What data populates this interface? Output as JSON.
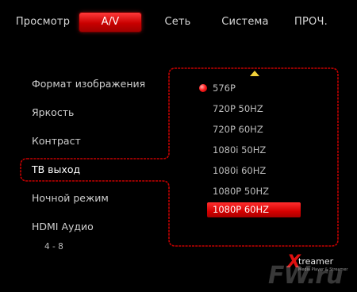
{
  "tabs": [
    {
      "label": "Просмотр"
    },
    {
      "label": "A/V"
    },
    {
      "label": "Сеть"
    },
    {
      "label": "Система"
    },
    {
      "label": "ПРОЧ."
    }
  ],
  "active_tab": "A/V",
  "menu": {
    "items": [
      {
        "label": "Формат изображения"
      },
      {
        "label": "Яркость"
      },
      {
        "label": "Контраст"
      },
      {
        "label": "ТВ выход"
      },
      {
        "label": "Ночной режим"
      },
      {
        "label": "HDMI Аудио"
      }
    ],
    "selected": "ТВ выход",
    "page_indicator": "4 - 8"
  },
  "options": {
    "items": [
      {
        "label": "576P"
      },
      {
        "label": "720P 50HZ"
      },
      {
        "label": "720P 60HZ"
      },
      {
        "label": "1080i 50HZ"
      },
      {
        "label": "1080i 60HZ"
      },
      {
        "label": "1080P 50HZ"
      },
      {
        "label": "1080P 60HZ"
      }
    ],
    "current": "576P",
    "highlighted": "1080P 60HZ"
  },
  "logo": {
    "brand": "treamer",
    "tagline": "Media Player & Streamer"
  },
  "watermark": "FW.ru",
  "colors": {
    "accent": "#e00000",
    "outline": "#c40000",
    "arrow": "#f2d23a",
    "background": "#000000"
  },
  "icons": [
    "radio-dot-icon",
    "scroll-up-arrow-icon"
  ]
}
